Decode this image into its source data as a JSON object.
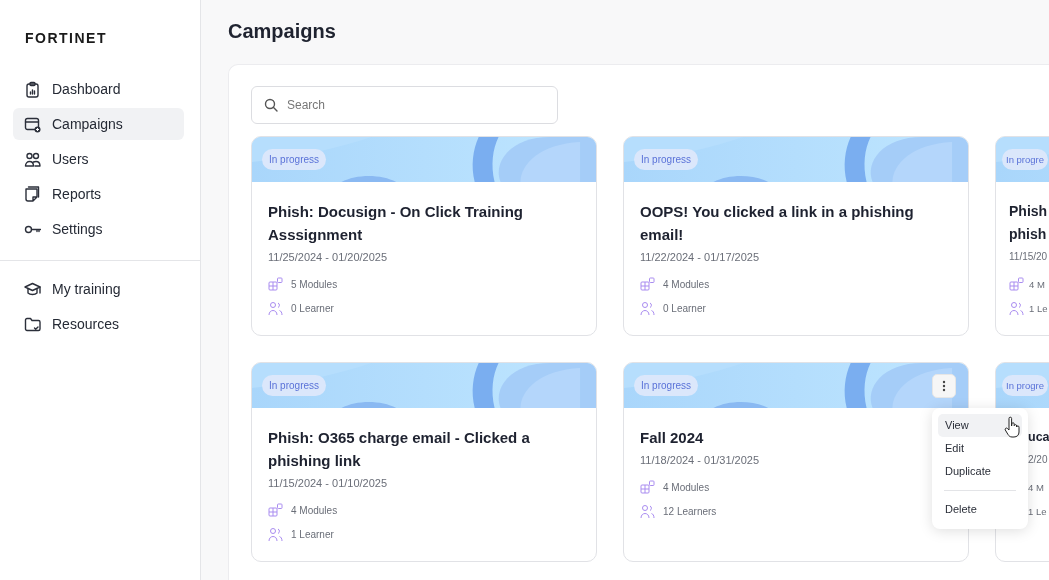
{
  "logo": "FORTINET",
  "sidebar": {
    "items": [
      {
        "label": "Dashboard",
        "selected": false
      },
      {
        "label": "Campaigns",
        "selected": true
      },
      {
        "label": "Users",
        "selected": false
      },
      {
        "label": "Reports",
        "selected": false
      },
      {
        "label": "Settings",
        "selected": false
      }
    ],
    "items_2": [
      {
        "label": "My training",
        "selected": false
      },
      {
        "label": "Resources",
        "selected": false
      }
    ]
  },
  "page_title": "Campaigns",
  "search": {
    "placeholder": "Search"
  },
  "cards": [
    {
      "status": "In progress",
      "title": "Phish: Docusign - On Click Training Asssignment",
      "dates": "11/25/2024 - 01/20/2025",
      "modules": "5 Modules",
      "learners": "0 Learner"
    },
    {
      "status": "In progress",
      "title": "OOPS! You clicked a link in a phishing email!",
      "dates": "11/22/2024 - 01/17/2025",
      "modules": "4 Modules",
      "learners": "0 Learner"
    },
    {
      "status": "In progre",
      "title": "Phish\nphish",
      "dates": "11/15/20",
      "modules": "4 M",
      "learners": "1 Le"
    },
    {
      "status": "In progress",
      "title": "Phish: O365 charge email - Clicked a phishing link",
      "dates": "11/15/2024 - 01/10/2025",
      "modules": "4 Modules",
      "learners": "1 Learner"
    },
    {
      "status": "In progress",
      "title": "Fall 2024",
      "dates": "11/18/2024 - 01/31/2025",
      "modules": "4 Modules",
      "learners": "12 Learners",
      "menu": {
        "items": [
          {
            "label": "View",
            "selected": true
          },
          {
            "label": "Edit",
            "selected": false
          },
          {
            "label": "Duplicate",
            "selected": false
          },
          {
            "label": "Delete",
            "selected": false
          }
        ]
      }
    },
    {
      "status": "In progre",
      "title": "uca",
      "dates": "2/20",
      "modules": "4 M",
      "learners": "1 Le"
    }
  ]
}
